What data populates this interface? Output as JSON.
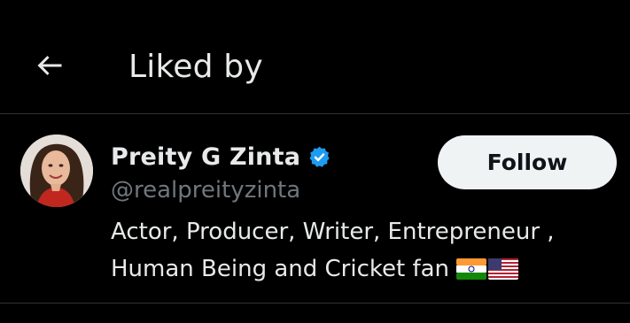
{
  "header": {
    "title": "Liked by",
    "back_icon": "arrow-left-icon"
  },
  "user": {
    "display_name": "Preity G Zinta",
    "handle": "@realpreityzinta",
    "verified": true,
    "verified_icon": "verified-badge-icon",
    "bio": "Actor, Producer, Writer, Entrepreneur , Human Being and Cricket fan",
    "bio_flags": [
      "india-flag-icon",
      "usa-flag-icon"
    ],
    "follow_label": "Follow"
  },
  "colors": {
    "background": "#000000",
    "text_primary": "#e7e9ea",
    "text_secondary": "#71767b",
    "divider": "#2f3336",
    "verified_blue": "#1d9bf0",
    "follow_bg": "#eff3f4",
    "follow_text": "#0f1419"
  }
}
